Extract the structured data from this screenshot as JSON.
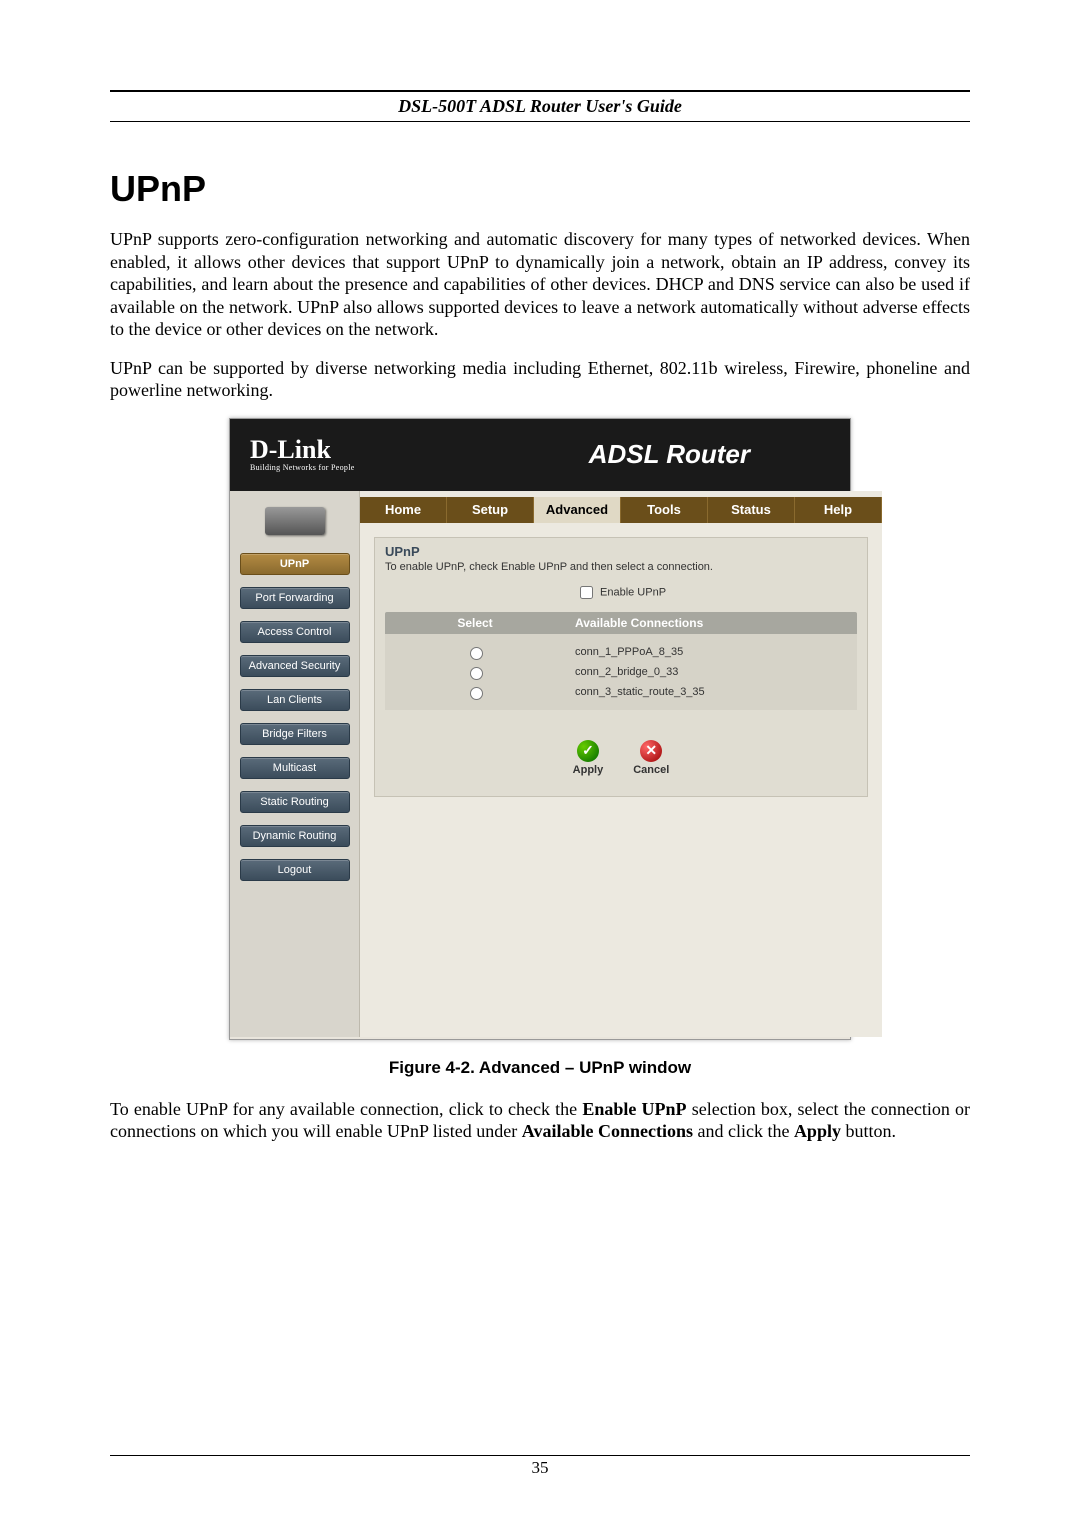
{
  "header": {
    "title": "DSL-500T ADSL Router User's Guide"
  },
  "section_heading": "UPnP",
  "para1": "UPnP supports zero-configuration networking and automatic discovery for many types of networked devices. When enabled, it allows other devices that support UPnP to dynamically join a network, obtain an IP address, convey its capabilities, and learn about the presence and capabilities of other devices. DHCP and DNS service can also be used if available on the network. UPnP also allows supported devices to leave a network automatically without adverse effects to the device or other devices on the network.",
  "para2": "UPnP can be supported by diverse networking media including Ethernet, 802.11b wireless, Firewire, phoneline and powerline networking.",
  "router": {
    "brand": "D-Link",
    "brand_tag": "Building Networks for People",
    "title": "ADSL Router",
    "tabs": [
      "Home",
      "Setup",
      "Advanced",
      "Tools",
      "Status",
      "Help"
    ],
    "active_tab": 2,
    "sidebar": [
      "UPnP",
      "Port Forwarding",
      "Access Control",
      "Advanced Security",
      "Lan Clients",
      "Bridge Filters",
      "Multicast",
      "Static Routing",
      "Dynamic Routing",
      "Logout"
    ],
    "active_side": 0,
    "panel": {
      "label": "UPnP",
      "note": "To enable UPnP, check Enable UPnP and then select a connection.",
      "enable_label": "Enable UPnP",
      "col_select": "Select",
      "col_avail": "Available Connections",
      "connections": [
        "conn_1_PPPoA_8_35",
        "conn_2_bridge_0_33",
        "conn_3_static_route_3_35"
      ],
      "apply": "Apply",
      "cancel": "Cancel"
    }
  },
  "figure_caption": "Figure 4-2. Advanced – UPnP window",
  "para3_a": "To enable UPnP for any available connection, click to check the ",
  "para3_b": "Enable UPnP",
  "para3_c": " selection box, select the connection or connections on which you will enable UPnP listed under ",
  "para3_d": "Available Connections",
  "para3_e": " and click the ",
  "para3_f": "Apply",
  "para3_g": " button.",
  "page_number": "35"
}
